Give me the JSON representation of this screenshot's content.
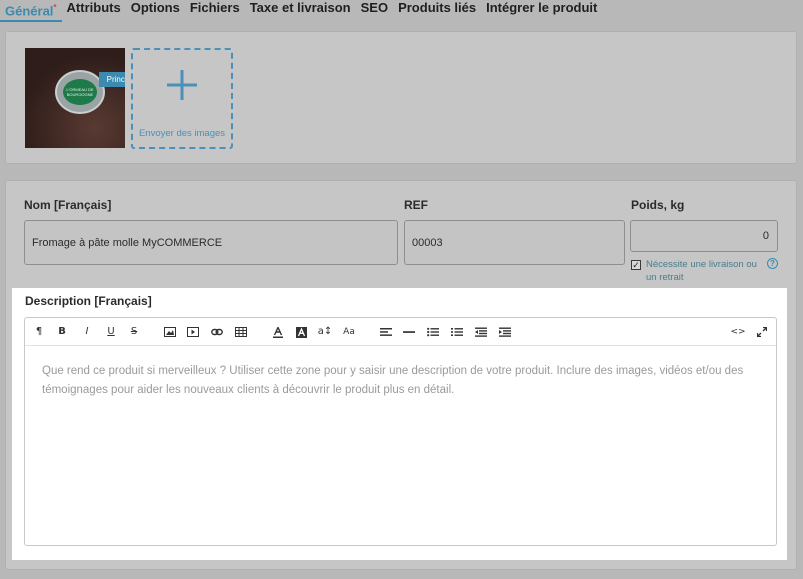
{
  "tabs": [
    {
      "label": "Général",
      "marker": "*"
    },
    {
      "label": "Attributs"
    },
    {
      "label": "Options"
    },
    {
      "label": "Fichiers"
    },
    {
      "label": "Taxe et livraison"
    },
    {
      "label": "SEO"
    },
    {
      "label": "Produits liés"
    },
    {
      "label": "Intégrer le produit"
    }
  ],
  "images": {
    "badge": "Principal",
    "product_lid_text": "L'ORMEAU DE BOURGOGNE",
    "upload_label": "Envoyer des images"
  },
  "fields": {
    "name_label": "Nom [Français]",
    "name_value": "Fromage à pâte molle MyCOMMERCE",
    "ref_label": "REF",
    "ref_value": "00003",
    "weight_label": "Poids, kg",
    "weight_value": "0",
    "shipping_checkbox_label": "Nécessite une livraison ou un retrait",
    "shipping_checked": true,
    "help_icon": "?"
  },
  "description": {
    "label": "Description [Français]",
    "placeholder": "Que rend ce produit si merveilleux ? Utiliser cette zone pour y saisir une description de votre produit. Inclure des images, vidéos et/ou des témoignages pour aider les nouveaux clients à découvrir le produit plus en détail.",
    "toolbar": {
      "paragraph": "¶",
      "bold": "B",
      "italic": "I",
      "underline": "U",
      "strike": "S",
      "superscript": "a↕",
      "case": "Aa",
      "code": "<>"
    }
  },
  "colors": {
    "accent": "#3b8ab0",
    "panel": "#c6c6c6",
    "backdrop": "#b8b8b8"
  }
}
